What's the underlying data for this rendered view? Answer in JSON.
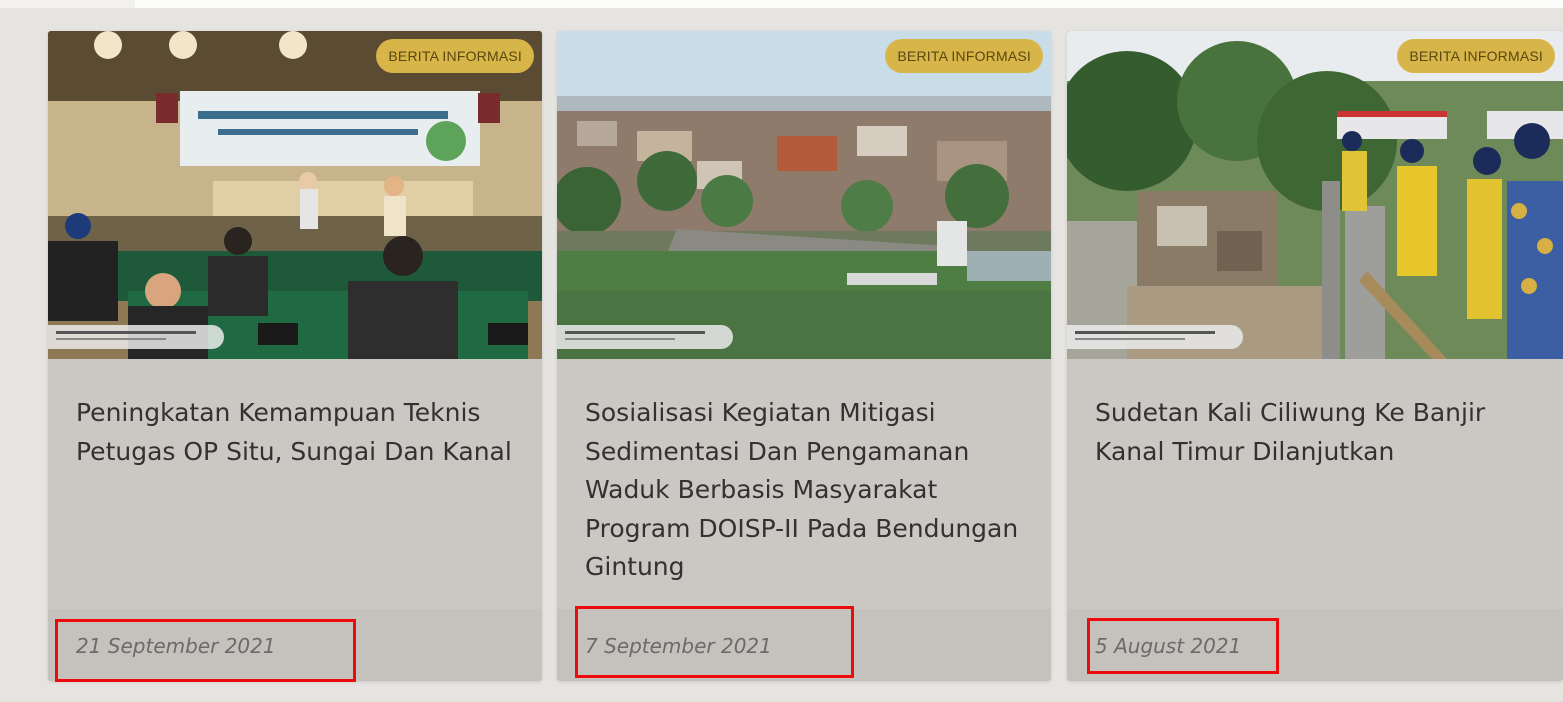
{
  "cards": [
    {
      "category": "BERITA INFORMASI",
      "title": "Peningkatan Kemampuan Teknis Petugas OP Situ, Sungai Dan Kanal",
      "date": "21 September 2021"
    },
    {
      "category": "BERITA INFORMASI",
      "title": "Sosialisasi Kegiatan Mitigasi Sedimentasi Dan Pengamanan Waduk Berbasis Masyarakat Program DOISP-II Pada Bendungan Gintung",
      "date": "7 September 2021"
    },
    {
      "category": "BERITA INFORMASI",
      "title": "Sudetan Kali Ciliwung Ke Banjir Kanal Timur Dilanjutkan",
      "date": "5 August 2021"
    }
  ],
  "colors": {
    "badge_bg": "#d7b548",
    "highlight_border": "#ee0a0a",
    "card_bg": "#cbc8c4",
    "title_text": "#333132"
  }
}
